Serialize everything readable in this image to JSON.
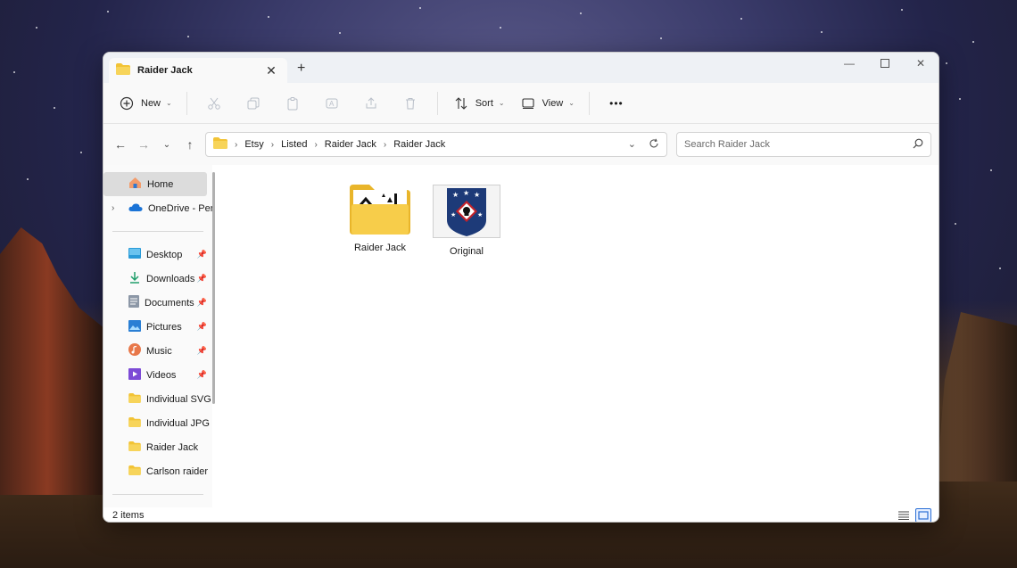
{
  "window": {
    "tab_title": "Raider Jack"
  },
  "toolbar": {
    "new_label": "New",
    "sort_label": "Sort",
    "view_label": "View",
    "more_label": "•••"
  },
  "address": {
    "crumbs": [
      "Etsy",
      "Listed",
      "Raider Jack",
      "Raider Jack"
    ]
  },
  "search": {
    "placeholder": "Search Raider Jack"
  },
  "sidebar": {
    "home": "Home",
    "onedrive": "OneDrive - Perso",
    "items": [
      {
        "label": "Desktop",
        "icon": "desktop-icon",
        "pinned": true
      },
      {
        "label": "Downloads",
        "icon": "download-icon",
        "pinned": true
      },
      {
        "label": "Documents",
        "icon": "documents-icon",
        "pinned": true
      },
      {
        "label": "Pictures",
        "icon": "pictures-icon",
        "pinned": true
      },
      {
        "label": "Music",
        "icon": "music-icon",
        "pinned": true
      },
      {
        "label": "Videos",
        "icon": "videos-icon",
        "pinned": true
      },
      {
        "label": "Individual SVG",
        "icon": "folder-icon",
        "pinned": false
      },
      {
        "label": "Individual JPG",
        "icon": "folder-icon",
        "pinned": false
      },
      {
        "label": "Raider Jack",
        "icon": "folder-icon",
        "pinned": false
      },
      {
        "label": "Carlson raider",
        "icon": "folder-icon",
        "pinned": false
      }
    ]
  },
  "files": [
    {
      "name": "Raider Jack",
      "type": "folder"
    },
    {
      "name": "Original",
      "type": "image"
    }
  ],
  "status": {
    "item_count": "2 items"
  },
  "colors": {
    "accent": "#2b6fd6",
    "folder": "#f2c335",
    "badge_navy": "#1d3a78",
    "badge_red": "#c4222a"
  }
}
